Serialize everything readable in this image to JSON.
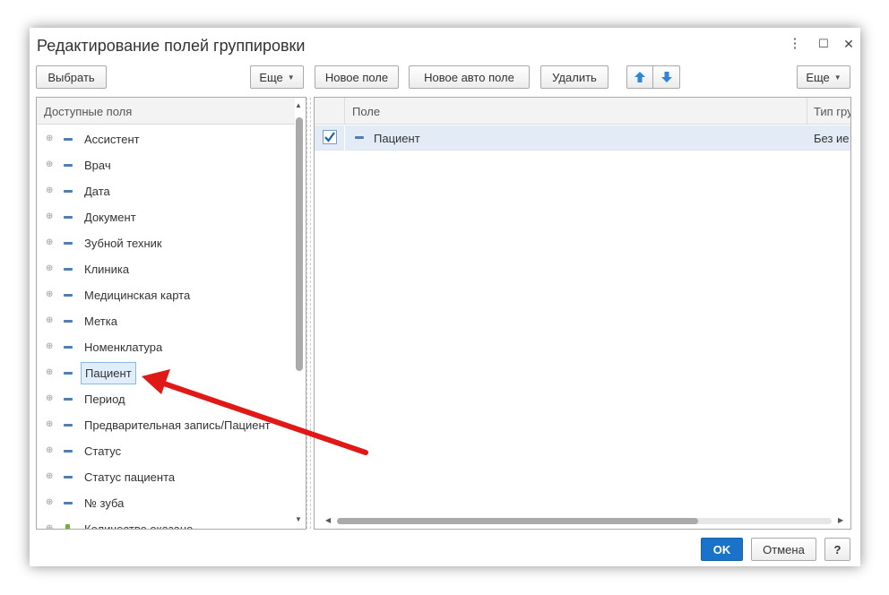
{
  "dialog": {
    "title": "Редактирование полей группировки",
    "menu_icon": "⋮",
    "maximize_icon": "☐",
    "close_icon": "✕"
  },
  "left_toolbar": {
    "select_label": "Выбрать",
    "more_label": "Еще"
  },
  "right_toolbar": {
    "new_field_label": "Новое поле",
    "new_auto_field_label": "Новое авто поле",
    "delete_label": "Удалить",
    "more_label": "Еще"
  },
  "available_fields": {
    "header": "Доступные поля",
    "items": [
      {
        "label": "Ассистент"
      },
      {
        "label": "Врач"
      },
      {
        "label": "Дата"
      },
      {
        "label": "Документ"
      },
      {
        "label": "Зубной техник"
      },
      {
        "label": "Клиника"
      },
      {
        "label": "Медицинская карта"
      },
      {
        "label": "Метка"
      },
      {
        "label": "Номенклатура"
      },
      {
        "label": "Пациент",
        "selected": true
      },
      {
        "label": "Период"
      },
      {
        "label": "Предварительная запись/Пациент"
      },
      {
        "label": "Статус"
      },
      {
        "label": "Статус пациента"
      },
      {
        "label": "№ зуба"
      },
      {
        "label": "Количество оказано"
      }
    ]
  },
  "grouping_table": {
    "columns": [
      "Поле",
      "Тип гру"
    ],
    "rows": [
      {
        "checked": true,
        "field": "Пациент",
        "type": "Без ие"
      }
    ]
  },
  "footer": {
    "ok_label": "OK",
    "cancel_label": "Отмена",
    "help_label": "?"
  },
  "colors": {
    "accent": "#1a73c8",
    "annotation_arrow": "#e01818",
    "arrow_buttons": "#2f86d6"
  }
}
